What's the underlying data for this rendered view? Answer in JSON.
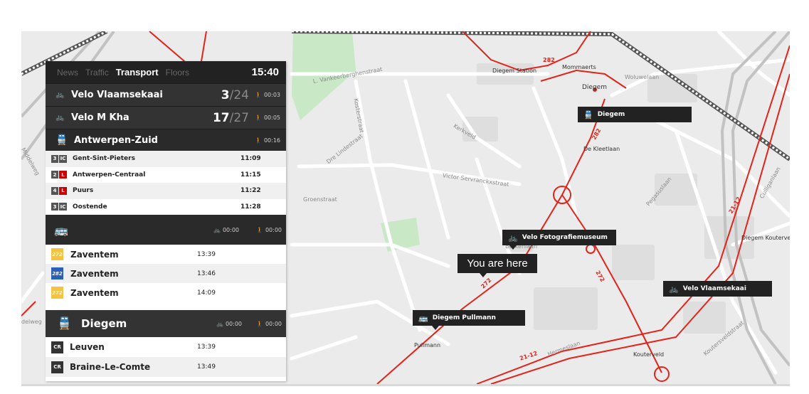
{
  "tabs": [
    {
      "label": "News",
      "active": false
    },
    {
      "label": "Traffic",
      "active": false
    },
    {
      "label": "Transport",
      "active": true
    },
    {
      "label": "Floors",
      "active": false
    }
  ],
  "clock": "15:40",
  "velo": [
    {
      "name": "Velo Vlaamsekaai",
      "available": "3",
      "total": "/24",
      "walk": "00:03"
    },
    {
      "name": "Velo M Kha",
      "available": "17",
      "total": "/27",
      "walk": "00:05"
    }
  ],
  "train_station": {
    "name": "Antwerpen-Zuid",
    "walk": "00:16",
    "departures": [
      {
        "platform": "3",
        "type": "IC",
        "type_color": "#555555",
        "destination": "Gent-Sint-Pieters",
        "time": "11:09"
      },
      {
        "platform": "2",
        "type": "L",
        "type_color": "#cc0000",
        "destination": "Antwerpen-Centraal",
        "time": "11:15"
      },
      {
        "platform": "4",
        "type": "L",
        "type_color": "#cc0000",
        "destination": "Puurs",
        "time": "11:22"
      },
      {
        "platform": "3",
        "type": "IC",
        "type_color": "#555555",
        "destination": "Oostende",
        "time": "11:28"
      }
    ]
  },
  "bus_stop": {
    "bike": "00:00",
    "walk": "00:00",
    "departures": [
      {
        "line": "272",
        "line_color": "#f5c242",
        "destination": "Zaventem",
        "time": "13:39"
      },
      {
        "line": "282",
        "line_color": "#2c5fb8",
        "destination": "Zaventem",
        "time": "13:46"
      },
      {
        "line": "272",
        "line_color": "#f5c242",
        "destination": "Zaventem",
        "time": "14:09"
      }
    ]
  },
  "diegem_station": {
    "name": "Diegem",
    "bike": "00:00",
    "walk": "00:00",
    "departures": [
      {
        "type": "CR",
        "destination": "Leuven",
        "time": "13:39"
      },
      {
        "type": "CR",
        "destination": "Braine-Le-Comte",
        "time": "13:49"
      }
    ]
  },
  "map": {
    "you_are_here": "You are here",
    "labels": {
      "diegem": "Diegem",
      "velo_foto": "Velo Fotografiemuseum",
      "velo_vlaamse": "Velo Vlaamsekaai",
      "diegem_pullmann": "Diegem Pullmann"
    },
    "places": {
      "diegem_town": "Diegem",
      "mommaerts": "Mommaerts",
      "diegem_station": "Diegem Station",
      "de_kleetlaan": "De Kleetlaan",
      "diegem_kouterveld": "Diegem Kouterveld",
      "kouterveld": "Kouterveld",
      "pullmann": "Pullmann"
    },
    "streets": {
      "vankeerberghen": "L. Vankeerberghenstraat",
      "woluwelaan": "Woluwelaan",
      "victor_servranckx": "Victor Servranckxstraat",
      "groenstraat": "Groenstraat",
      "kerkveld": "Kerkveld",
      "kosterstraat": "Kosterstraat",
      "de_lindestraat": "Dre Lindestraat",
      "cuzi": "Culliganlaan",
      "hermeslaan": "Hermeslaan",
      "pegasuslaan": "Pegasuslaan",
      "koutersveldstraat": "Koutersveldstraat",
      "middelweg": "Middelweg",
      "delweg": "delweg",
      "berkenlaan": "Berkenlaan"
    },
    "routes": [
      "282",
      "272",
      "21",
      "12",
      "21-12"
    ]
  }
}
